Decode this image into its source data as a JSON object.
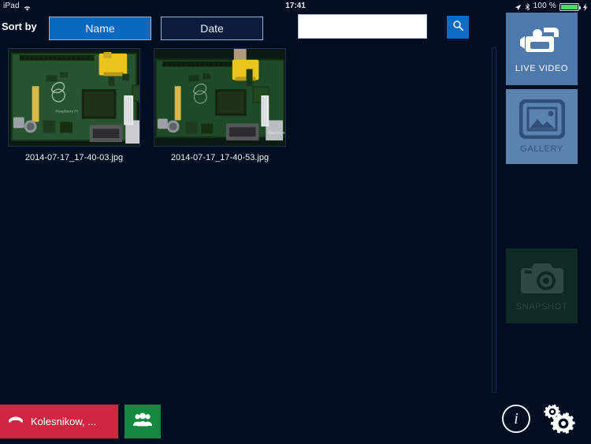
{
  "statusbar": {
    "device": "iPad",
    "wifi_icon": "wifi-icon",
    "time": "17:41",
    "location_icon": "location-arrow-icon",
    "bluetooth_icon": "bluetooth-icon",
    "battery_percent": "100 %",
    "battery_icon": "battery-full-icon",
    "charging_icon": "charging-bolt-icon"
  },
  "toolbar": {
    "sort_label": "Sort by",
    "sort_name": "Name",
    "sort_date": "Date",
    "sort_selected": "Name"
  },
  "search": {
    "value": "",
    "placeholder": "",
    "button_icon": "search-icon"
  },
  "gallery": {
    "items": [
      {
        "filename": "2014-07-17_17-40-03.jpg",
        "alt": "raspberry-pi-board-photo"
      },
      {
        "filename": "2014-07-17_17-40-53.jpg",
        "alt": "raspberry-pi-board-photo"
      }
    ]
  },
  "rail": {
    "live_video": {
      "label": "LIVE VIDEO",
      "icon": "video-camera-icon",
      "bg": "#4e79ad"
    },
    "gallery": {
      "label": "GALLERY",
      "icon": "image-icon",
      "bg": "#5b83b0"
    },
    "snapshot": {
      "label": "SNAPSHOT",
      "icon": "camera-icon",
      "bg": "#0d2b23"
    }
  },
  "bottombar": {
    "call_name": "Kolesnikow, ...",
    "hangup_icon": "hangup-phone-icon",
    "call_bg": "#cf2741",
    "group_icon": "group-people-icon",
    "group_bg": "#13883f",
    "info_icon": "info-icon",
    "info_glyph": "i",
    "settings_icon": "gears-icon"
  },
  "theme": {
    "background": "#010d20",
    "accent_blue": "#0a6cc4",
    "selected_blue": "#0a68c0",
    "battery_green": "#4cd964"
  }
}
